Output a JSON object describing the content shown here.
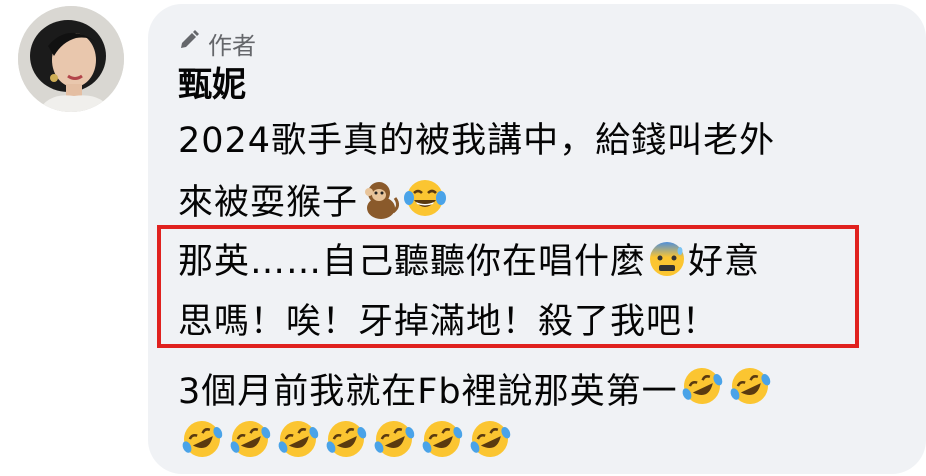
{
  "comment": {
    "author_badge": "作者",
    "author_name": "甄妮",
    "lines": [
      "2024歌手真的被我講中，給錢叫老外",
      "來被耍猴子",
      "那英……自己聽聽你在唱什麼",
      "好意",
      "思嗎！唉！牙掉滿地！殺了我吧！",
      "3個月前我就在Fb裡說那英第一"
    ],
    "emoji": {
      "monkey": "monkey-emoji",
      "tears_of_joy": "face-with-tears-of-joy-emoji",
      "anxious": "anxious-face-with-sweat-emoji",
      "rofl": "rolling-on-the-floor-laughing-emoji"
    }
  },
  "highlight_color": "#e0211e"
}
